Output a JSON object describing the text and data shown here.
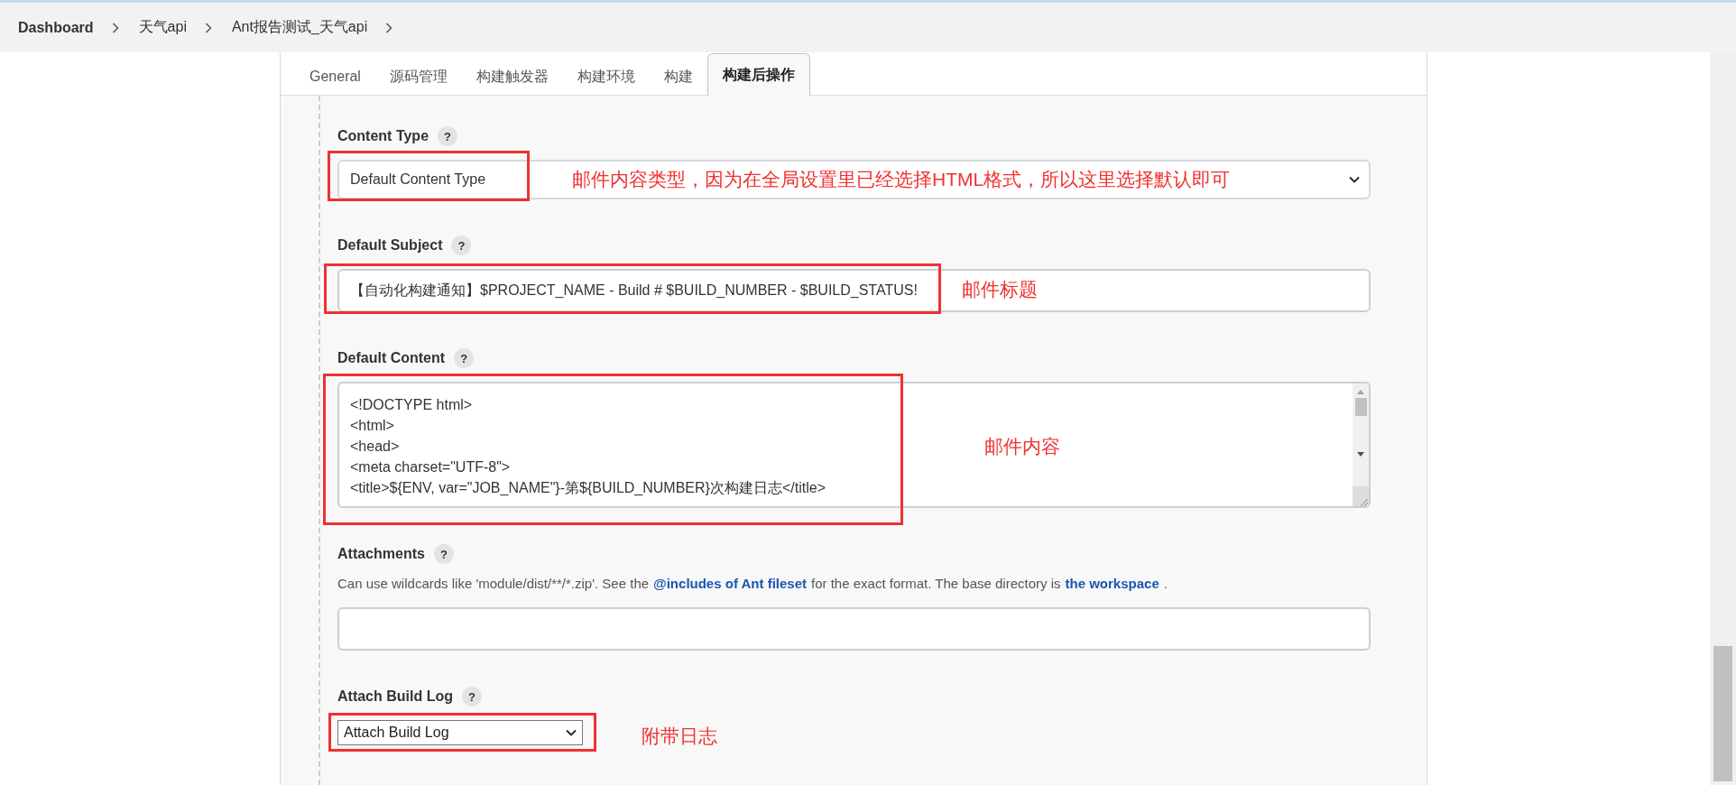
{
  "breadcrumb": [
    {
      "label": "Dashboard"
    },
    {
      "label": "天气api"
    },
    {
      "label": "Ant报告测试_天气api"
    }
  ],
  "tabs": [
    {
      "label": "General",
      "selected": false
    },
    {
      "label": "源码管理",
      "selected": false
    },
    {
      "label": "构建触发器",
      "selected": false
    },
    {
      "label": "构建环境",
      "selected": false
    },
    {
      "label": "构建",
      "selected": false
    },
    {
      "label": "构建后操作",
      "selected": true
    }
  ],
  "fields": [
    {
      "kind": "select",
      "label": "Content Type",
      "help": "?",
      "value": "Default Content Type",
      "annotation": "邮件内容类型，因为在全局设置里已经选择HTML格式，所以这里选择默认即可"
    },
    {
      "kind": "text",
      "label": "Default Subject",
      "help": "?",
      "value": "【自动化构建通知】$PROJECT_NAME - Build # $BUILD_NUMBER - $BUILD_STATUS!",
      "annotation": "邮件标题"
    },
    {
      "kind": "textarea",
      "label": "Default Content",
      "help": "?",
      "lines": [
        "<!DOCTYPE html>",
        "<html>",
        "<head>",
        "<meta charset=\"UTF-8\">",
        "<title>${ENV, var=\"JOB_NAME\"}-第${BUILD_NUMBER}次构建日志</title>"
      ],
      "annotation": "邮件内容"
    },
    {
      "kind": "text",
      "label": "Attachments",
      "help": "?",
      "description": [
        {
          "kind": "text",
          "text": "Can use wildcards like 'module/dist/**/*.zip'. See the"
        },
        {
          "kind": "link",
          "text": "@includes of Ant fileset"
        },
        {
          "kind": "text",
          "text": "for the exact format. The base directory is"
        },
        {
          "kind": "link",
          "text": "the workspace"
        },
        {
          "kind": "text",
          "text": "."
        }
      ]
    },
    {
      "kind": "smallselect",
      "label": "Attach Build Log",
      "help": "?",
      "value": "Attach Build Log",
      "annotation": "附带日志"
    }
  ]
}
